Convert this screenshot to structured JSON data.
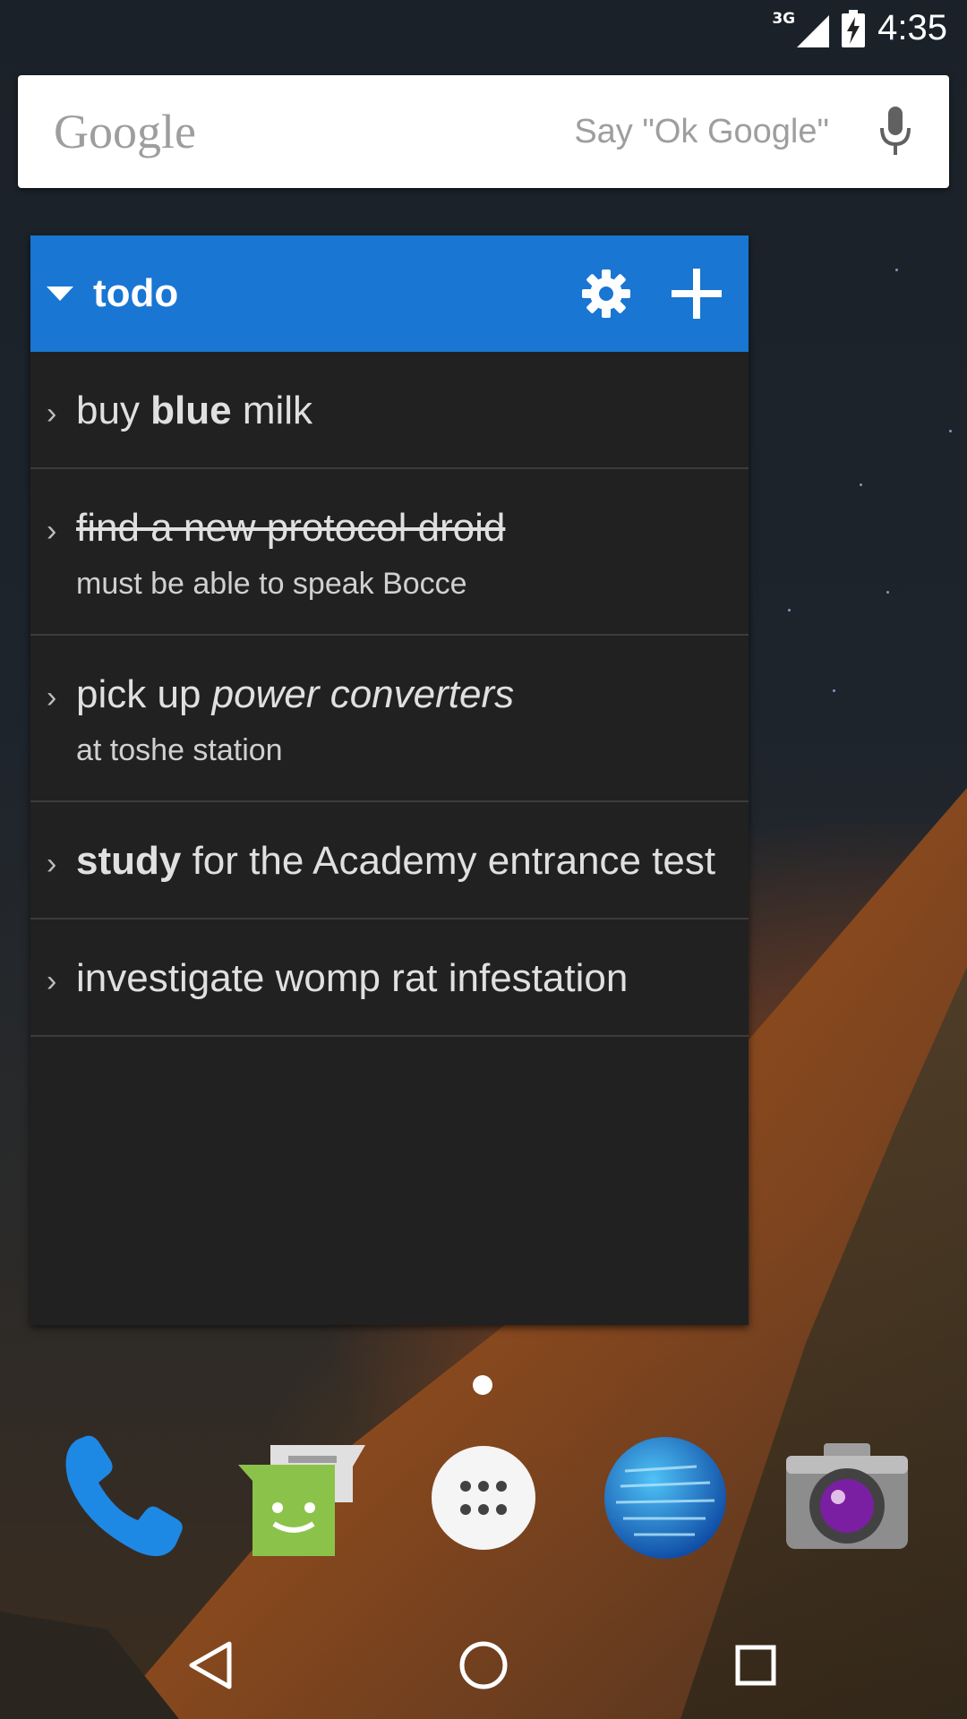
{
  "status_bar": {
    "network": "3G",
    "time": "4:35"
  },
  "search": {
    "logo": "Google",
    "hint": "Say \"Ok Google\""
  },
  "widget": {
    "title": "todo",
    "accent_color": "#1976d2",
    "items": [
      {
        "segments": [
          {
            "text": "buy ",
            "style": "normal"
          },
          {
            "text": "blue",
            "style": "bold"
          },
          {
            "text": " milk",
            "style": "normal"
          }
        ],
        "note": "",
        "done": false
      },
      {
        "segments": [
          {
            "text": "find a new protocol droid",
            "style": "normal"
          }
        ],
        "note": "must be able to speak Bocce",
        "done": true
      },
      {
        "segments": [
          {
            "text": "pick up ",
            "style": "normal"
          },
          {
            "text": "power converters",
            "style": "italic"
          }
        ],
        "note": "at toshe station",
        "done": false
      },
      {
        "segments": [
          {
            "text": "study",
            "style": "bold"
          },
          {
            "text": " for the Academy entrance test",
            "style": "normal"
          }
        ],
        "note": "",
        "done": false
      },
      {
        "segments": [
          {
            "text": "investigate womp rat infestation",
            "style": "normal"
          }
        ],
        "note": "",
        "done": false
      }
    ]
  },
  "dock": {
    "apps": [
      {
        "name": "phone-app-icon"
      },
      {
        "name": "messenger-app-icon"
      },
      {
        "name": "app-drawer-icon"
      },
      {
        "name": "browser-app-icon"
      },
      {
        "name": "camera-app-icon"
      }
    ]
  },
  "nav": {
    "buttons": [
      "back-icon",
      "home-icon",
      "recents-icon"
    ]
  }
}
